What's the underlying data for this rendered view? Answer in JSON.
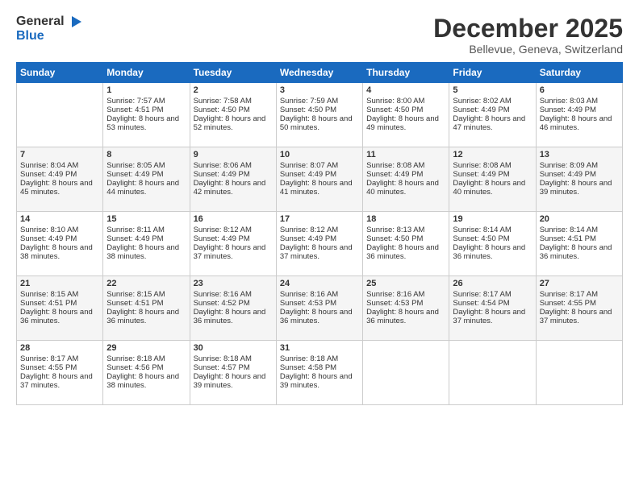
{
  "header": {
    "logo_general": "General",
    "logo_blue": "Blue",
    "month": "December 2025",
    "location": "Bellevue, Geneva, Switzerland"
  },
  "days_header": [
    "Sunday",
    "Monday",
    "Tuesday",
    "Wednesday",
    "Thursday",
    "Friday",
    "Saturday"
  ],
  "weeks": [
    [
      {
        "day": "",
        "sunrise": "",
        "sunset": "",
        "daylight": ""
      },
      {
        "day": "1",
        "sunrise": "Sunrise: 7:57 AM",
        "sunset": "Sunset: 4:51 PM",
        "daylight": "Daylight: 8 hours and 53 minutes."
      },
      {
        "day": "2",
        "sunrise": "Sunrise: 7:58 AM",
        "sunset": "Sunset: 4:50 PM",
        "daylight": "Daylight: 8 hours and 52 minutes."
      },
      {
        "day": "3",
        "sunrise": "Sunrise: 7:59 AM",
        "sunset": "Sunset: 4:50 PM",
        "daylight": "Daylight: 8 hours and 50 minutes."
      },
      {
        "day": "4",
        "sunrise": "Sunrise: 8:00 AM",
        "sunset": "Sunset: 4:50 PM",
        "daylight": "Daylight: 8 hours and 49 minutes."
      },
      {
        "day": "5",
        "sunrise": "Sunrise: 8:02 AM",
        "sunset": "Sunset: 4:49 PM",
        "daylight": "Daylight: 8 hours and 47 minutes."
      },
      {
        "day": "6",
        "sunrise": "Sunrise: 8:03 AM",
        "sunset": "Sunset: 4:49 PM",
        "daylight": "Daylight: 8 hours and 46 minutes."
      }
    ],
    [
      {
        "day": "7",
        "sunrise": "Sunrise: 8:04 AM",
        "sunset": "Sunset: 4:49 PM",
        "daylight": "Daylight: 8 hours and 45 minutes."
      },
      {
        "day": "8",
        "sunrise": "Sunrise: 8:05 AM",
        "sunset": "Sunset: 4:49 PM",
        "daylight": "Daylight: 8 hours and 44 minutes."
      },
      {
        "day": "9",
        "sunrise": "Sunrise: 8:06 AM",
        "sunset": "Sunset: 4:49 PM",
        "daylight": "Daylight: 8 hours and 42 minutes."
      },
      {
        "day": "10",
        "sunrise": "Sunrise: 8:07 AM",
        "sunset": "Sunset: 4:49 PM",
        "daylight": "Daylight: 8 hours and 41 minutes."
      },
      {
        "day": "11",
        "sunrise": "Sunrise: 8:08 AM",
        "sunset": "Sunset: 4:49 PM",
        "daylight": "Daylight: 8 hours and 40 minutes."
      },
      {
        "day": "12",
        "sunrise": "Sunrise: 8:08 AM",
        "sunset": "Sunset: 4:49 PM",
        "daylight": "Daylight: 8 hours and 40 minutes."
      },
      {
        "day": "13",
        "sunrise": "Sunrise: 8:09 AM",
        "sunset": "Sunset: 4:49 PM",
        "daylight": "Daylight: 8 hours and 39 minutes."
      }
    ],
    [
      {
        "day": "14",
        "sunrise": "Sunrise: 8:10 AM",
        "sunset": "Sunset: 4:49 PM",
        "daylight": "Daylight: 8 hours and 38 minutes."
      },
      {
        "day": "15",
        "sunrise": "Sunrise: 8:11 AM",
        "sunset": "Sunset: 4:49 PM",
        "daylight": "Daylight: 8 hours and 38 minutes."
      },
      {
        "day": "16",
        "sunrise": "Sunrise: 8:12 AM",
        "sunset": "Sunset: 4:49 PM",
        "daylight": "Daylight: 8 hours and 37 minutes."
      },
      {
        "day": "17",
        "sunrise": "Sunrise: 8:12 AM",
        "sunset": "Sunset: 4:49 PM",
        "daylight": "Daylight: 8 hours and 37 minutes."
      },
      {
        "day": "18",
        "sunrise": "Sunrise: 8:13 AM",
        "sunset": "Sunset: 4:50 PM",
        "daylight": "Daylight: 8 hours and 36 minutes."
      },
      {
        "day": "19",
        "sunrise": "Sunrise: 8:14 AM",
        "sunset": "Sunset: 4:50 PM",
        "daylight": "Daylight: 8 hours and 36 minutes."
      },
      {
        "day": "20",
        "sunrise": "Sunrise: 8:14 AM",
        "sunset": "Sunset: 4:51 PM",
        "daylight": "Daylight: 8 hours and 36 minutes."
      }
    ],
    [
      {
        "day": "21",
        "sunrise": "Sunrise: 8:15 AM",
        "sunset": "Sunset: 4:51 PM",
        "daylight": "Daylight: 8 hours and 36 minutes."
      },
      {
        "day": "22",
        "sunrise": "Sunrise: 8:15 AM",
        "sunset": "Sunset: 4:51 PM",
        "daylight": "Daylight: 8 hours and 36 minutes."
      },
      {
        "day": "23",
        "sunrise": "Sunrise: 8:16 AM",
        "sunset": "Sunset: 4:52 PM",
        "daylight": "Daylight: 8 hours and 36 minutes."
      },
      {
        "day": "24",
        "sunrise": "Sunrise: 8:16 AM",
        "sunset": "Sunset: 4:53 PM",
        "daylight": "Daylight: 8 hours and 36 minutes."
      },
      {
        "day": "25",
        "sunrise": "Sunrise: 8:16 AM",
        "sunset": "Sunset: 4:53 PM",
        "daylight": "Daylight: 8 hours and 36 minutes."
      },
      {
        "day": "26",
        "sunrise": "Sunrise: 8:17 AM",
        "sunset": "Sunset: 4:54 PM",
        "daylight": "Daylight: 8 hours and 37 minutes."
      },
      {
        "day": "27",
        "sunrise": "Sunrise: 8:17 AM",
        "sunset": "Sunset: 4:55 PM",
        "daylight": "Daylight: 8 hours and 37 minutes."
      }
    ],
    [
      {
        "day": "28",
        "sunrise": "Sunrise: 8:17 AM",
        "sunset": "Sunset: 4:55 PM",
        "daylight": "Daylight: 8 hours and 37 minutes."
      },
      {
        "day": "29",
        "sunrise": "Sunrise: 8:18 AM",
        "sunset": "Sunset: 4:56 PM",
        "daylight": "Daylight: 8 hours and 38 minutes."
      },
      {
        "day": "30",
        "sunrise": "Sunrise: 8:18 AM",
        "sunset": "Sunset: 4:57 PM",
        "daylight": "Daylight: 8 hours and 39 minutes."
      },
      {
        "day": "31",
        "sunrise": "Sunrise: 8:18 AM",
        "sunset": "Sunset: 4:58 PM",
        "daylight": "Daylight: 8 hours and 39 minutes."
      },
      {
        "day": "",
        "sunrise": "",
        "sunset": "",
        "daylight": ""
      },
      {
        "day": "",
        "sunrise": "",
        "sunset": "",
        "daylight": ""
      },
      {
        "day": "",
        "sunrise": "",
        "sunset": "",
        "daylight": ""
      }
    ]
  ]
}
